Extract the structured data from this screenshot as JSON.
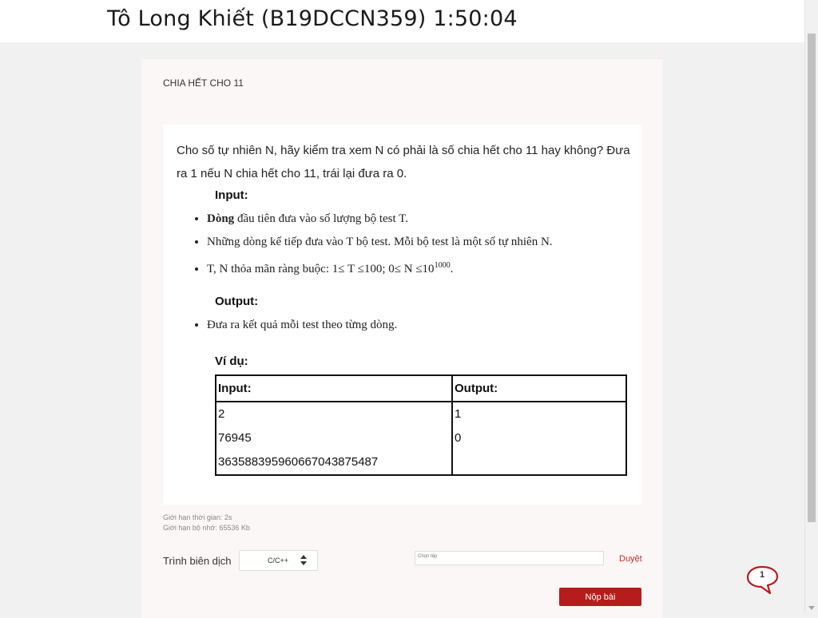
{
  "header": {
    "title": "Tô Long Khiết (B19DCCN359) 1:50:04"
  },
  "problem": {
    "title": "CHIA HẾT CHO 11",
    "description": "Cho số tự nhiên N, hãy kiểm tra xem N có phải là số chia hết cho 11 hay không? Đưa ra 1 nếu N chia hết cho 11, trái lại đưa ra 0.",
    "input_heading": "Input:",
    "input_bullets": {
      "b1_bold": "Dòng",
      "b1_rest": " đầu tiên đưa vào số lượng bộ test T.",
      "b2": "Những dòng kế tiếp đưa vào T bộ test. Mỗi bộ test là một số tự nhiên N.",
      "b3_text": "T, N thỏa mãn ràng buộc: 1≤ T ≤100; 0≤ N ≤10",
      "b3_sup": "1000",
      "b3_end": "."
    },
    "output_heading": "Output:",
    "output_bullet": "Đưa ra kết quả mỗi test theo từng dòng.",
    "example_heading": "Ví dụ:",
    "example_table": {
      "header_input": "Input:",
      "header_output": "Output:",
      "input_lines": [
        "2",
        "76945",
        "363588395960667043875487"
      ],
      "output_lines": [
        "1",
        "0"
      ]
    }
  },
  "limits": {
    "time": "Giới hạn thời gian: 2s",
    "memory": "Giới hạn bộ nhớ: 65536 Kb"
  },
  "submission": {
    "compiler_label": "Trình biên dịch",
    "compiler_value": "C/C++",
    "file_placeholder": "Chọn tệp",
    "browse_label": "Duyệt",
    "submit_label": "Nộp bài"
  },
  "notification": {
    "count": "1"
  },
  "colors": {
    "accent": "#b71c1c",
    "link": "#c0302c",
    "card_bg": "#fbf7f6",
    "page_bg": "#f1f1f1"
  }
}
